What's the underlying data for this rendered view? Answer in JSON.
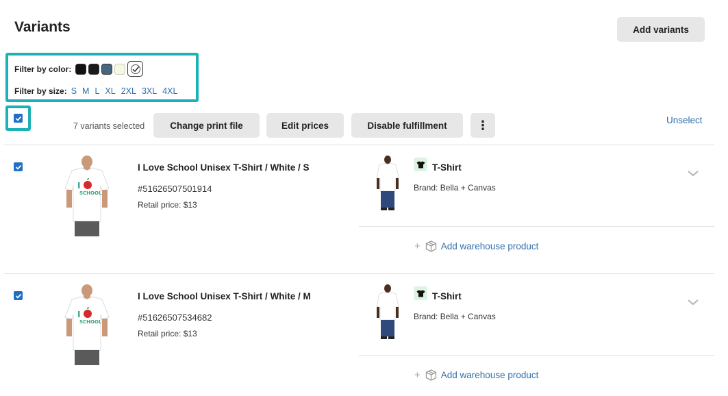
{
  "header": {
    "title": "Variants",
    "add_variants_label": "Add variants"
  },
  "filters": {
    "color_label": "Filter by color:",
    "colors": [
      "#111111",
      "#1a1a1a",
      "#46677e",
      "#f6f8e3"
    ],
    "size_label": "Filter by size:",
    "sizes": [
      "S",
      "M",
      "L",
      "XL",
      "2XL",
      "3XL",
      "4XL"
    ]
  },
  "toolbar": {
    "selected_count": "7 variants selected",
    "change_print_file": "Change print file",
    "edit_prices": "Edit prices",
    "disable_fulfillment": "Disable fulfillment",
    "more_icon": "⋮",
    "unselect": "Unselect"
  },
  "variants": [
    {
      "title": "I Love School Unisex T-Shirt / White / S",
      "sku": "#51626507501914",
      "price": "Retail price: $13",
      "product_name": "T-Shirt",
      "brand": "Brand: Bella + Canvas",
      "add_warehouse": "Add warehouse product"
    },
    {
      "title": "I Love School Unisex T-Shirt / White / M",
      "sku": "#51626507534682",
      "price": "Retail price: $13",
      "product_name": "T-Shirt",
      "brand": "Brand: Bella + Canvas",
      "add_warehouse": "Add warehouse product"
    }
  ],
  "shirt_print": {
    "letter": "I",
    "word": "SCHOOL"
  }
}
